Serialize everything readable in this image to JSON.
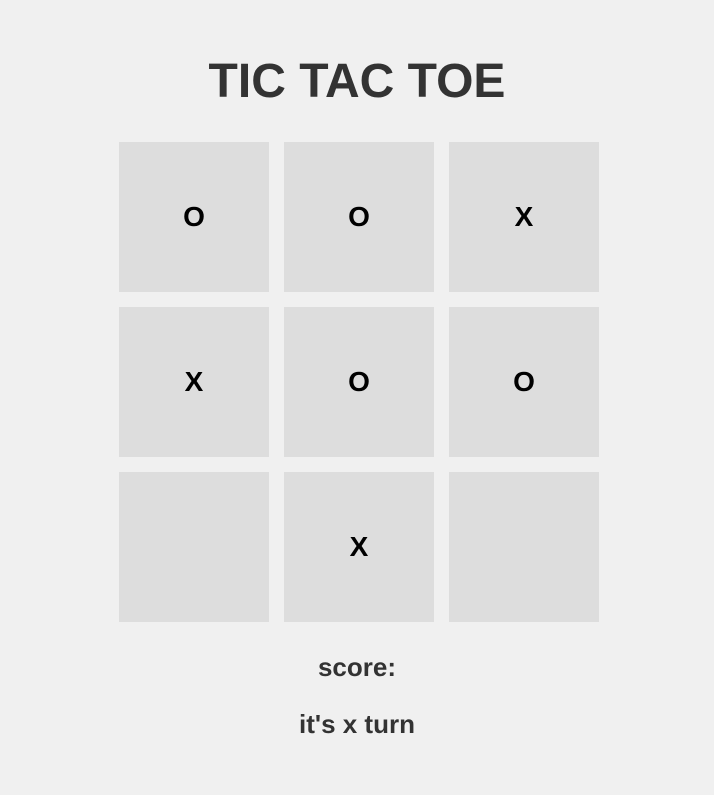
{
  "title": "TIC TAC TOE",
  "board": {
    "cells": [
      "o",
      "o",
      "x",
      "x",
      "o",
      "o",
      "",
      "x",
      ""
    ]
  },
  "status": {
    "score_label": "score:",
    "turn_text": "it's x turn"
  },
  "colors": {
    "background": "#f0f0f0",
    "cell": "#dddddd",
    "text": "#333333",
    "mark": "#000000"
  }
}
